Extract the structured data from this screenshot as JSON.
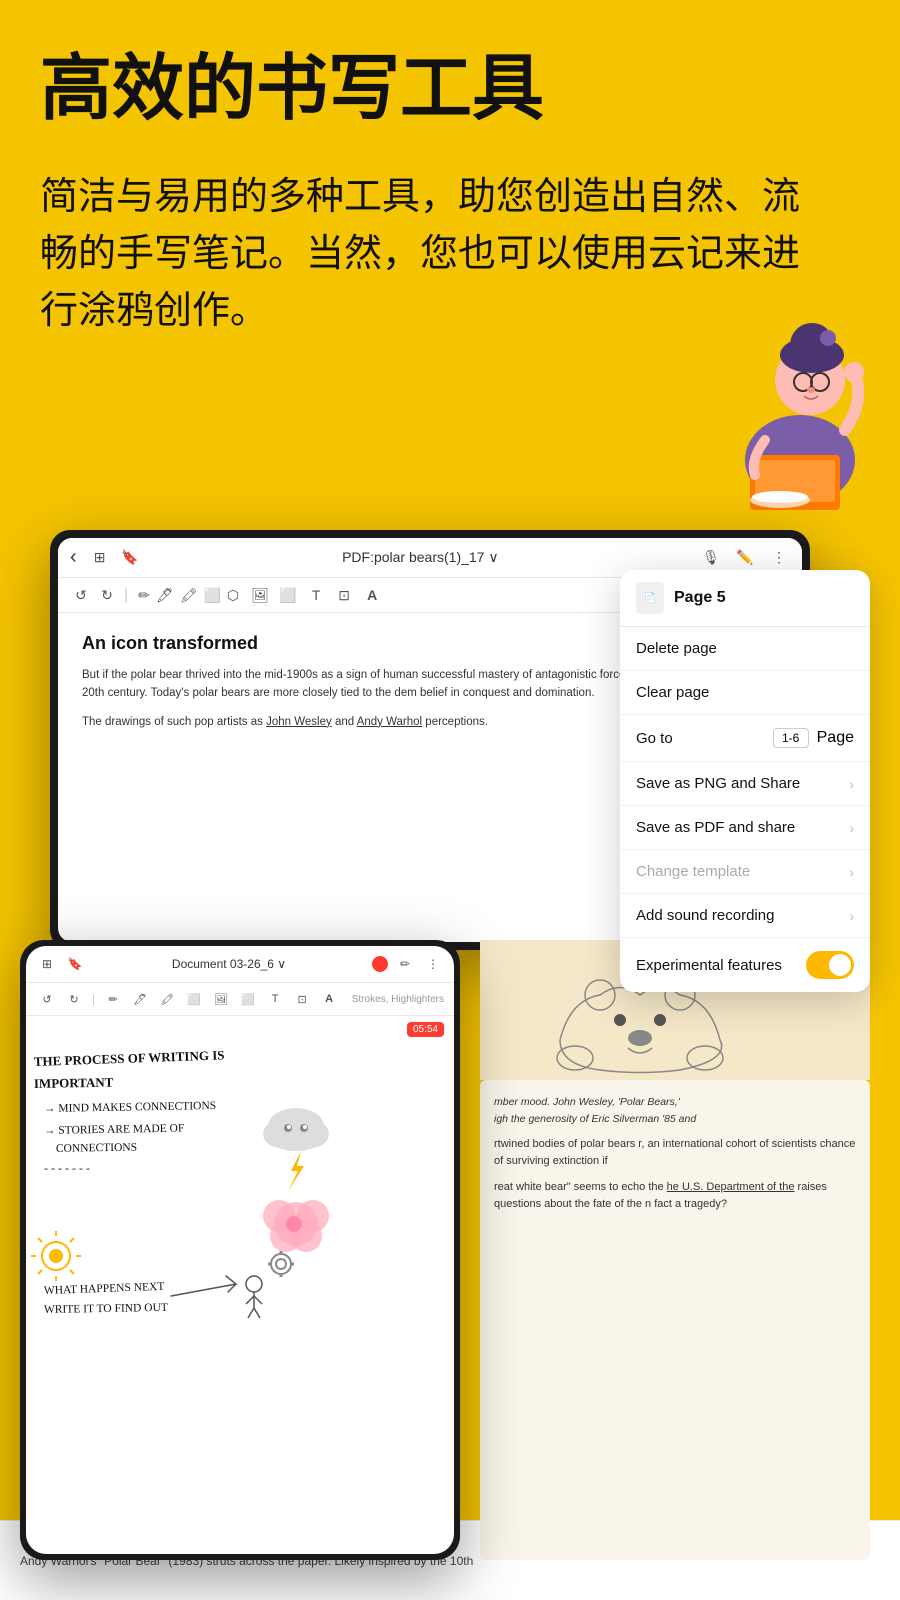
{
  "header": {
    "title": "高效的书写工具",
    "subtitle": "简洁与易用的多种工具，助您创造出自然、流畅的手写笔记。当然，您也可以使用云记来进行涂鸦创作。"
  },
  "tablet_main": {
    "title": "PDF:polar bears(1)_17 ∨",
    "doc_heading": "An icon transformed",
    "doc_body_1": "But if the polar bear thrived into the mid-1900s as a sign of human successful mastery of antagonistic forces, this symbolic associatio 20th century. Today's polar bears are more closely tied to the dem belief in conquest and domination.",
    "doc_body_2": "The drawings of such pop artists as John Wesley and Andy Warhol perceptions."
  },
  "context_menu": {
    "page_label": "Page 5",
    "items": [
      {
        "label": "Delete page",
        "disabled": false,
        "has_chevron": false,
        "has_input": false,
        "has_toggle": false
      },
      {
        "label": "Clear page",
        "disabled": false,
        "has_chevron": false,
        "has_input": false,
        "has_toggle": false
      },
      {
        "label": "Go to",
        "disabled": false,
        "has_chevron": false,
        "has_input": true,
        "input_placeholder": "1-6",
        "suffix": "Page",
        "has_toggle": false
      },
      {
        "label": "Save as PNG and Share",
        "disabled": false,
        "has_chevron": true,
        "has_input": false,
        "has_toggle": false
      },
      {
        "label": "Save as PDF and share",
        "disabled": false,
        "has_chevron": true,
        "has_input": false,
        "has_toggle": false
      },
      {
        "label": "Change template",
        "disabled": true,
        "has_chevron": true,
        "has_input": false,
        "has_toggle": false
      },
      {
        "label": "Add sound recording",
        "disabled": false,
        "has_chevron": true,
        "has_input": false,
        "has_toggle": false
      },
      {
        "label": "Experimental features",
        "disabled": false,
        "has_chevron": false,
        "has_input": false,
        "has_toggle": true
      }
    ]
  },
  "tablet_small": {
    "title": "Document 03-26_6 ∨",
    "strokes_label": "Strokes, Highlighters",
    "timer": "05:54",
    "handwriting": [
      "THE PROCESS OF WRITING IS",
      "IMPORTANT",
      "→ MIND MAKES CONNECTIONS",
      "→ STORIES ARE MADE OF",
      "   CONNECTIONS",
      "- - - - - - -",
      "WHAT HAPPENS NEXT",
      "WRITE IT TO FIND OUT"
    ]
  },
  "bottom_doc": {
    "bear_caption": "mber mood. John Wesley, 'Polar Bears,' igh the generosity of Eric Silverman '85 and",
    "para1": "rtwined bodies of polar bears r, an international cohort of scientists chance of surviving extinction if",
    "para2": "reat white bear\" seems to echo the he U.S. Department of the raises questions about the fate of the n fact a tragedy?",
    "footer_text": "Andy Warhol's \"Polar Bear\" (1983) struts across the paper. Likely inspired by the 10th",
    "dept_text": "Department of the"
  },
  "colors": {
    "background": "#F5C400",
    "toggle_active": "#FFB800",
    "red": "#FF3B30"
  }
}
